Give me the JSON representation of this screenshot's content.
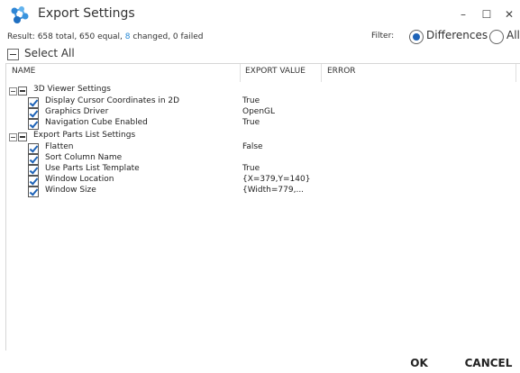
{
  "window": {
    "title": "Export Settings",
    "minimize_glyph": "–",
    "maximize_glyph": "☐",
    "close_glyph": "✕",
    "app_icon": "molecule-network-icon"
  },
  "result": {
    "prefix": "Result: 658 total, 650 equal, ",
    "changed_count": "8",
    "changed_suffix": " changed, 0 failed"
  },
  "filter": {
    "label": "Filter:",
    "options": [
      {
        "label": "Differences",
        "selected": true
      },
      {
        "label": "All",
        "selected": false
      }
    ]
  },
  "select_all": {
    "label": "Select All",
    "state": "indeterminate"
  },
  "columns": [
    "NAME",
    "EXPORT VALUE",
    "ERROR"
  ],
  "groups": [
    {
      "label": "3D Viewer Settings",
      "items": [
        {
          "label": "Display Cursor Coordinates in 2D",
          "value": "True",
          "checked": true
        },
        {
          "label": "Graphics Driver",
          "value": "OpenGL",
          "checked": true
        },
        {
          "label": "Navigation Cube Enabled",
          "value": "True",
          "checked": true
        }
      ]
    },
    {
      "label": "Export Parts List Settings",
      "items": [
        {
          "label": "Flatten",
          "value": "False",
          "checked": true
        },
        {
          "label": "Sort Column Name",
          "value": "",
          "checked": true
        },
        {
          "label": "Use Parts List Template",
          "value": "True",
          "checked": true
        },
        {
          "label": "Window Location",
          "value": "{X=379,Y=140}",
          "checked": true
        },
        {
          "label": "Window Size",
          "value": "{Width=779,...",
          "checked": true
        }
      ]
    }
  ],
  "buttons": {
    "ok": "OK",
    "cancel": "CANCEL"
  },
  "colors": {
    "accent": "#1e63b7",
    "changed": "#2a8bd6"
  }
}
